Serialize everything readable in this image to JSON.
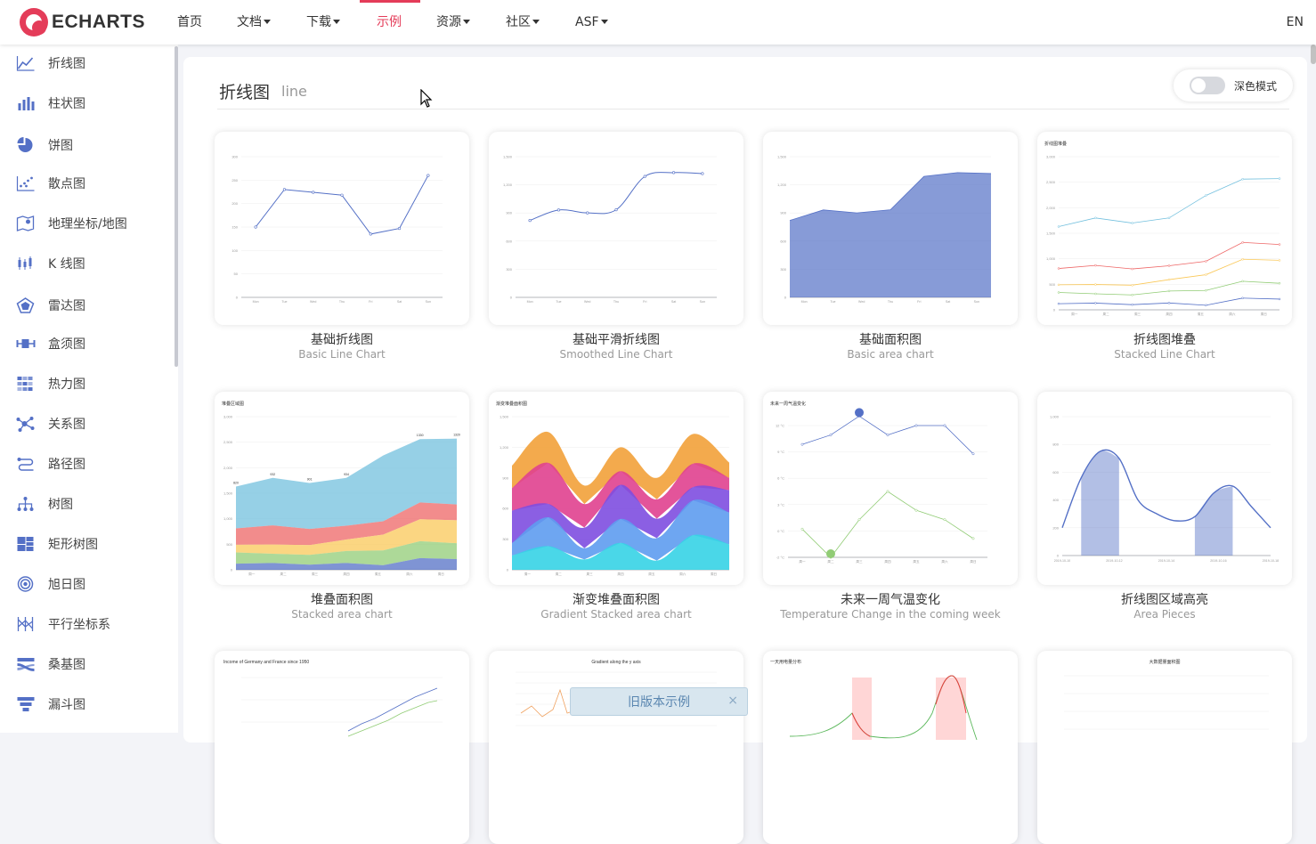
{
  "header": {
    "brand": "ECHARTS",
    "nav": [
      {
        "label": "首页",
        "dropdown": false
      },
      {
        "label": "文档",
        "dropdown": true
      },
      {
        "label": "下载",
        "dropdown": true
      },
      {
        "label": "示例",
        "dropdown": false,
        "active": true
      },
      {
        "label": "资源",
        "dropdown": true
      },
      {
        "label": "社区",
        "dropdown": true
      },
      {
        "label": "ASF",
        "dropdown": true
      }
    ],
    "lang": "EN",
    "accent_color": "#e43c59"
  },
  "sidebar": {
    "items": [
      {
        "label": "折线图",
        "icon": "line-chart-icon"
      },
      {
        "label": "柱状图",
        "icon": "bar-chart-icon"
      },
      {
        "label": "饼图",
        "icon": "pie-chart-icon"
      },
      {
        "label": "散点图",
        "icon": "scatter-chart-icon"
      },
      {
        "label": "地理坐标/地图",
        "icon": "map-icon"
      },
      {
        "label": "K 线图",
        "icon": "candlestick-icon"
      },
      {
        "label": "雷达图",
        "icon": "radar-icon"
      },
      {
        "label": "盒须图",
        "icon": "boxplot-icon"
      },
      {
        "label": "热力图",
        "icon": "heatmap-icon"
      },
      {
        "label": "关系图",
        "icon": "graph-icon"
      },
      {
        "label": "路径图",
        "icon": "lines-icon"
      },
      {
        "label": "树图",
        "icon": "tree-icon"
      },
      {
        "label": "矩形树图",
        "icon": "treemap-icon"
      },
      {
        "label": "旭日图",
        "icon": "sunburst-icon"
      },
      {
        "label": "平行坐标系",
        "icon": "parallel-icon"
      },
      {
        "label": "桑基图",
        "icon": "sankey-icon"
      },
      {
        "label": "漏斗图",
        "icon": "funnel-icon"
      }
    ]
  },
  "main": {
    "title": "折线图",
    "subtitle": "line",
    "dark_mode": {
      "label": "深色模式",
      "on": false
    },
    "examples": [
      {
        "title": "基础折线图",
        "subtitle": "Basic Line Chart"
      },
      {
        "title": "基础平滑折线图",
        "subtitle": "Smoothed Line Chart"
      },
      {
        "title": "基础面积图",
        "subtitle": "Basic area chart"
      },
      {
        "title": "折线图堆叠",
        "subtitle": "Stacked Line Chart"
      },
      {
        "title": "堆叠面积图",
        "subtitle": "Stacked area chart"
      },
      {
        "title": "渐变堆叠面积图",
        "subtitle": "Gradient Stacked area chart"
      },
      {
        "title": "未来一周气温变化",
        "subtitle": "Temperature Change in the coming week"
      },
      {
        "title": "折线图区域高亮",
        "subtitle": "Area Pieces"
      },
      {
        "title": "",
        "subtitle": ""
      },
      {
        "title": "",
        "subtitle": ""
      },
      {
        "title": "",
        "subtitle": ""
      },
      {
        "title": "",
        "subtitle": ""
      }
    ],
    "thumb_titles": {
      "stacked_line": "折线图堆叠",
      "stacked_area": "堆叠区域图",
      "gradient_area": "渐变堆叠面积图",
      "weather": "未来一周气温变化",
      "income": "Income of Germany and France since 1950",
      "gradient_axis": "Gradient along the y axis",
      "electricity": "一天用电量分布",
      "large_area": "大数据量面积图"
    }
  },
  "legacy_banner": {
    "label": "旧版本示例",
    "close": "×"
  }
}
